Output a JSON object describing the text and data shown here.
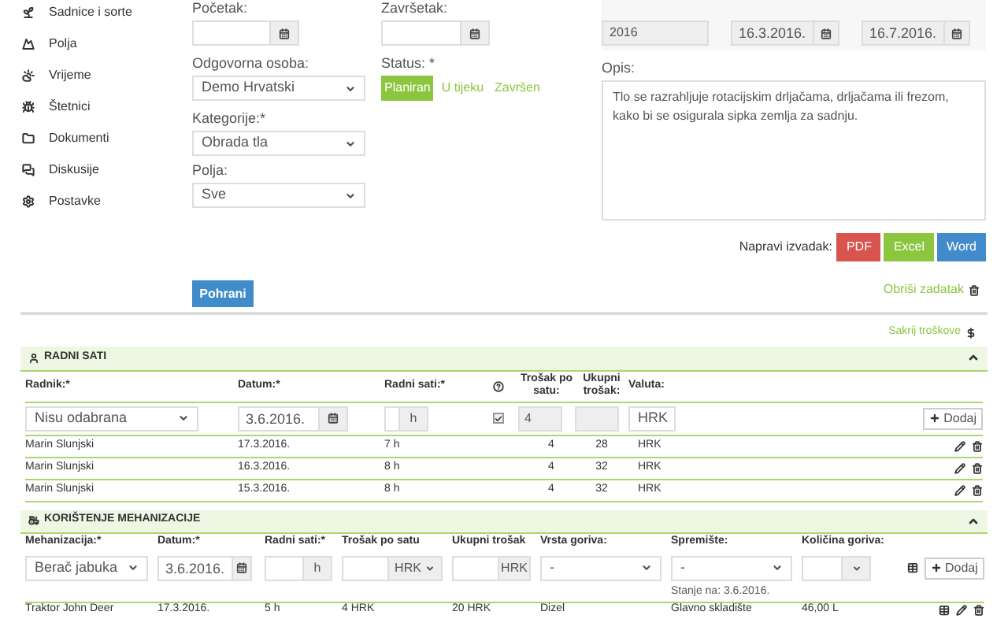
{
  "sidebar": {
    "items": [
      {
        "label": "Sadnice i sorte"
      },
      {
        "label": "Polja"
      },
      {
        "label": "Vrijeme"
      },
      {
        "label": "Štetnici"
      },
      {
        "label": "Dokumenti"
      },
      {
        "label": "Diskusije"
      },
      {
        "label": "Postavke"
      }
    ]
  },
  "form": {
    "start": {
      "label": "Početak:"
    },
    "end": {
      "label": "Završetak:"
    },
    "responsible": {
      "label": "Odgovorna osoba:",
      "value": "Demo Hrvatski"
    },
    "category": {
      "label": "Kategorije:*",
      "value": "Obrada tla"
    },
    "fields": {
      "label": "Polja:",
      "value": "Sve"
    },
    "status": {
      "label": "Status: *",
      "options": [
        {
          "label": "Planiran",
          "selected": true
        },
        {
          "label": "U tijeku",
          "selected": false
        },
        {
          "label": "Završen",
          "selected": false
        }
      ]
    },
    "season": {
      "value": "2016"
    },
    "period_start": {
      "value": "16.3.2016."
    },
    "period_end": {
      "value": "16.7.2016."
    },
    "description": {
      "label": "Opis:",
      "value": "Tlo se razrahljuje rotacijskim drljačama, drljačama ili frezom,  kako bi se osigurala sipka zemlja za sadnju."
    },
    "export": {
      "label": "Napravi izvadak:",
      "buttons": [
        {
          "label": "PDF",
          "color": "#d9534f"
        },
        {
          "label": "Excel",
          "color": "#8cc63f"
        },
        {
          "label": "Word",
          "color": "#428bca"
        }
      ]
    },
    "save": "Pohrani",
    "delete": "Obriši zadatak"
  },
  "hide_costs": "Sakrij troškove",
  "work_hours": {
    "title": "RADNI SATI",
    "columns": [
      "Radnik:*",
      "Datum:*",
      "Radni sati:*",
      "Trošak po satu:",
      "Ukupni trošak:",
      "Valuta:"
    ],
    "input": {
      "worker": "Nisu odabrana",
      "date": "3.6.2016.",
      "unit": "h",
      "checked": true,
      "cost": "4",
      "currency": "HRK",
      "add": "Dodaj"
    },
    "rows": [
      {
        "cells": [
          "Marin Slunjski",
          "17.3.2016.",
          "7 h",
          "4",
          "28",
          "HRK"
        ]
      },
      {
        "cells": [
          "Marin Slunjski",
          "16.3.2016.",
          "8 h",
          "4",
          "32",
          "HRK"
        ]
      },
      {
        "cells": [
          "Marin Slunjski",
          "15.3.2016.",
          "8 h",
          "4",
          "32",
          "HRK"
        ]
      }
    ]
  },
  "machinery": {
    "title": "KORIŠTENJE MEHANIZACIJE",
    "columns": [
      "Mehanizacija:*",
      "Datum:*",
      "Radni sati:*",
      "Trošak po satu",
      "Ukupni trošak",
      "Vrsta goriva:",
      "Spremište:",
      "Količina goriva:"
    ],
    "input": {
      "machine": "Berač jabuka",
      "date": "3.6.2016.",
      "unit": "h",
      "cost_currency": "HRK",
      "total_unit": "HRK",
      "fuel": "-",
      "storage": "-",
      "storage_note": "Stanje na: 3.6.2016.",
      "add": "Dodaj"
    },
    "rows": [
      {
        "cells": [
          "Traktor John Deer",
          "17.3.2016.",
          "5 h",
          "4 HRK",
          "20 HRK",
          "Dizel",
          "Glavno skladište",
          "46,00 L"
        ]
      }
    ]
  }
}
